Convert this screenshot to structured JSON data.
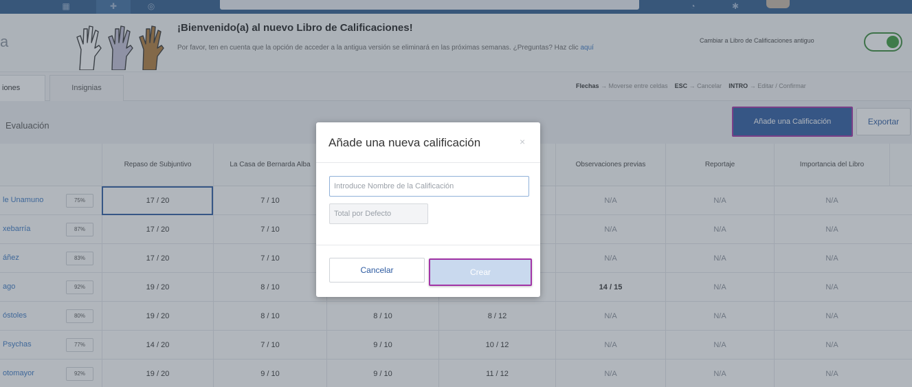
{
  "banner": {
    "page_letter": "a",
    "title": "¡Bienvenido(a) al nuevo Libro de Calificaciones!",
    "notice": "Por favor, ten en cuenta que la opción de acceder a la antigua versión se eliminará en las próximas semanas. ¿Preguntas? Haz clic",
    "notice_link": "aquí",
    "switch_label": "Cambiar a Libro de Calificaciones antiguo"
  },
  "tabs": [
    {
      "label": "iones"
    },
    {
      "label": "Insignias"
    }
  ],
  "shortcuts": {
    "arrows_key": "Flechas",
    "arrows_desc": "→ Moverse entre celdas",
    "esc_key": "ESC",
    "esc_desc": "→ Cancelar",
    "enter_key": "INTRO",
    "enter_desc": "→ Editar / Confirmar"
  },
  "toolbar": {
    "evaluation": "Evaluación",
    "add_label": "Añade una Calificación",
    "export_label": "Exportar"
  },
  "grid": {
    "headers": [
      "Repaso de Subjuntivo",
      "La Casa de Bernarda Alba",
      "",
      "",
      "Observaciones previas",
      "Reportaje",
      "Importancia del Libro"
    ],
    "rows": [
      {
        "name": "le Unamuno",
        "pct": "75%",
        "cells": [
          "17 / 20",
          "7 / 10",
          "",
          "",
          "N/A",
          "N/A",
          "N/A"
        ]
      },
      {
        "name": "xebarría",
        "pct": "87%",
        "cells": [
          "17 / 20",
          "7 / 10",
          "",
          "",
          "N/A",
          "N/A",
          "N/A"
        ]
      },
      {
        "name": "áñez",
        "pct": "83%",
        "cells": [
          "17 / 20",
          "7 / 10",
          "",
          "",
          "N/A",
          "N/A",
          "N/A"
        ]
      },
      {
        "name": "ago",
        "pct": "92%",
        "cells": [
          "19 / 20",
          "8 / 10",
          "",
          "",
          "14 / 15",
          "N/A",
          "N/A"
        ]
      },
      {
        "name": "óstoles",
        "pct": "80%",
        "cells": [
          "19 / 20",
          "8 / 10",
          "8 / 10",
          "8 / 12",
          "N/A",
          "N/A",
          "N/A"
        ]
      },
      {
        "name": "Psychas",
        "pct": "77%",
        "cells": [
          "14 / 20",
          "7 / 10",
          "9 / 10",
          "10 / 12",
          "N/A",
          "N/A",
          "N/A"
        ]
      },
      {
        "name": "otomayor",
        "pct": "92%",
        "cells": [
          "19 / 20",
          "9 / 10",
          "9 / 10",
          "11 / 12",
          "N/A",
          "N/A",
          "N/A"
        ]
      }
    ]
  },
  "modal": {
    "title": "Añade una nueva calificación",
    "close": "×",
    "name_placeholder": "Introduce Nombre de la Calificación",
    "total_placeholder": "Total por Defecto",
    "cancel_label": "Cancelar",
    "create_label": "Crear"
  },
  "colors": {
    "nav": "#2f5c8e",
    "primary": "#2c5aa0",
    "highlight": "#a233a6",
    "toggle_on": "#3a9a3a"
  }
}
